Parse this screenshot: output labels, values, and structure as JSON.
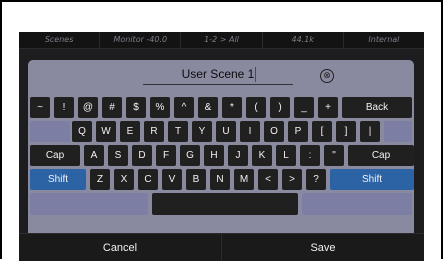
{
  "status_bar": {
    "scenes": "Scenes",
    "monitor": "Monitor -40.0",
    "routing": "1-2 > All",
    "sample_rate": "44.1k",
    "clock": "Internal"
  },
  "name_field": {
    "value": "User Scene 1",
    "clear_icon": "⊗"
  },
  "keyboard": {
    "row1": [
      "~",
      "!",
      "@",
      "#",
      "$",
      "%",
      "^",
      "&",
      "*",
      "(",
      ")",
      "_",
      "+",
      "Back"
    ],
    "row2": [
      "Q",
      "W",
      "E",
      "R",
      "T",
      "Y",
      "U",
      "I",
      "O",
      "P",
      "[",
      "]",
      "|"
    ],
    "row3": [
      "Cap",
      "A",
      "S",
      "D",
      "F",
      "G",
      "H",
      "J",
      "K",
      "L",
      ":",
      "\"",
      "Cap"
    ],
    "row4": [
      "Shift",
      "Z",
      "X",
      "C",
      "V",
      "B",
      "N",
      "M",
      "<",
      ">",
      "?",
      "Shift"
    ],
    "space_label": ""
  },
  "actions": {
    "cancel": "Cancel",
    "save": "Save"
  },
  "colors": {
    "panel": "#898aa0",
    "key": "#202021",
    "shift_key": "#2b63a4",
    "background": "#1d1d1f"
  }
}
